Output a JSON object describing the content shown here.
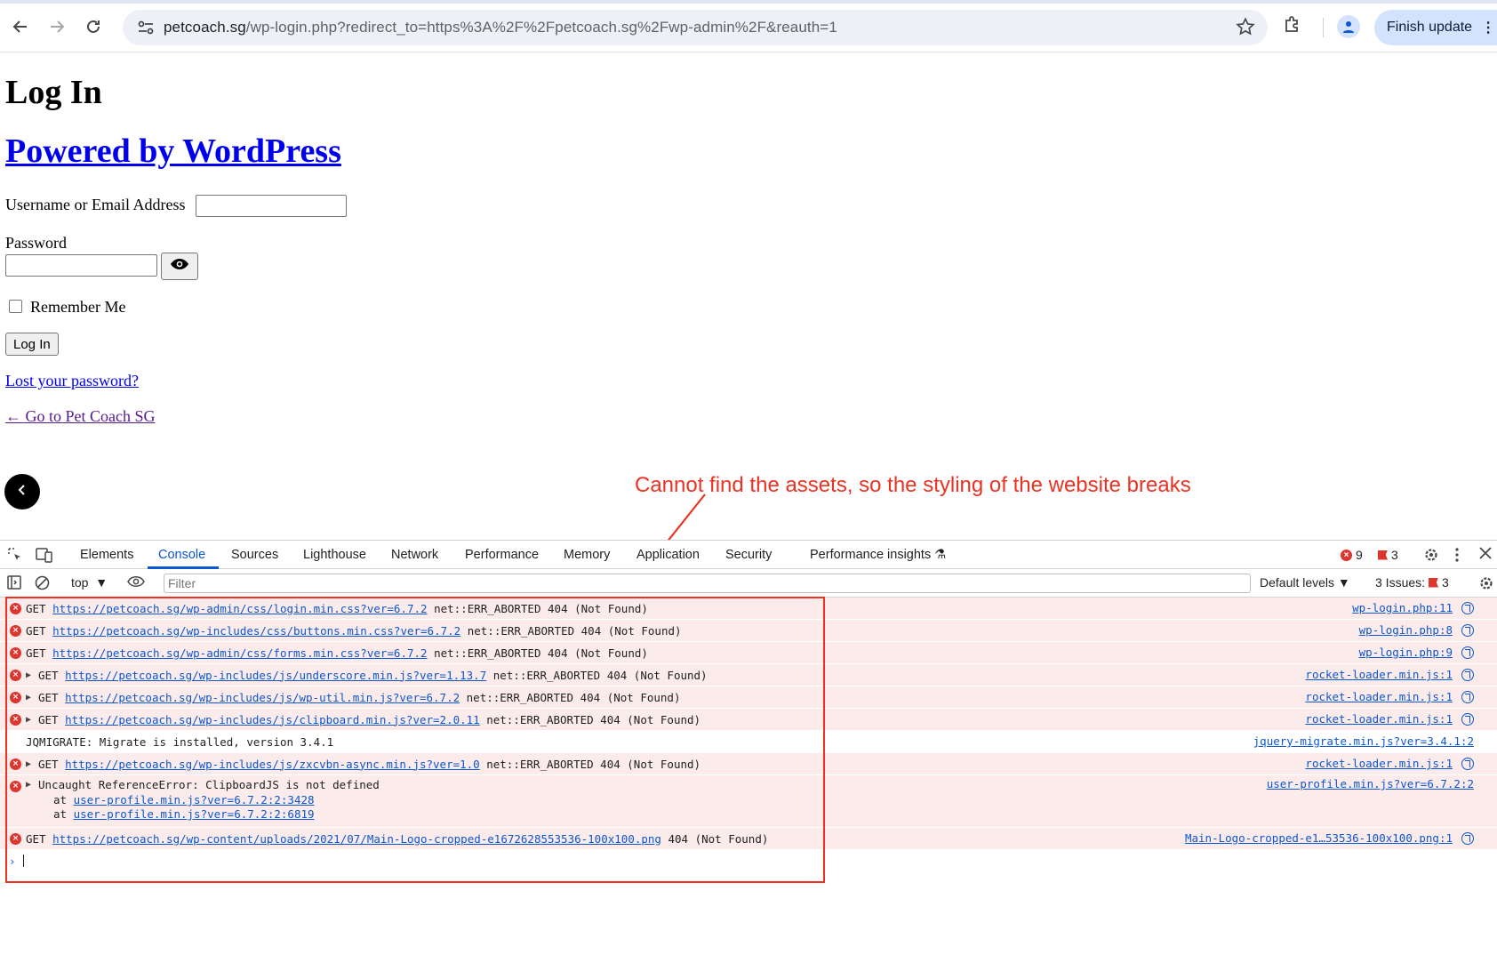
{
  "browser": {
    "url_host": "petcoach.sg",
    "url_path": "/wp-login.php?redirect_to=https%3A%2F%2Fpetcoach.sg%2Fwp-admin%2F&reauth=1",
    "finish_update_label": "Finish update",
    "icons": [
      "back-arrow-icon",
      "forward-arrow-icon",
      "reload-icon",
      "site-settings-icon",
      "star-icon",
      "extensions-icon",
      "profile-icon",
      "kebab-menu-icon"
    ]
  },
  "page": {
    "title": "Log In",
    "powered_by": "Powered by WordPress",
    "username_label": "Username or Email Address",
    "username_value": "",
    "password_label": "Password",
    "password_value": "",
    "remember_label": "Remember Me",
    "login_button": "Log In",
    "lost_password": "Lost your password?",
    "back_link": "← Go to Pet Coach SG"
  },
  "annotation": {
    "text": "Cannot find the assets, so the styling of the website breaks",
    "color": "#ea3323"
  },
  "devtools": {
    "tabs": [
      "Elements",
      "Console",
      "Sources",
      "Lighthouse",
      "Network",
      "Performance",
      "Memory",
      "Application",
      "Security",
      "Performance insights"
    ],
    "active_tab": "Console",
    "error_count": "9",
    "issue_flag_count": "3",
    "context": "top",
    "filter_placeholder": "Filter",
    "levels": "Default levels",
    "issues_label": "3 Issues:",
    "issues_count": "3",
    "console": [
      {
        "type": "error",
        "expandable": false,
        "method": "GET",
        "url": "https://petcoach.sg/wp-admin/css/login.min.css?ver=6.7.2",
        "msg": "net::ERR_ABORTED 404 (Not Found)",
        "source": "wp-login.php:11"
      },
      {
        "type": "error",
        "expandable": false,
        "method": "GET",
        "url": "https://petcoach.sg/wp-includes/css/buttons.min.css?ver=6.7.2",
        "msg": "net::ERR_ABORTED 404 (Not Found)",
        "source": "wp-login.php:8"
      },
      {
        "type": "error",
        "expandable": false,
        "method": "GET",
        "url": "https://petcoach.sg/wp-admin/css/forms.min.css?ver=6.7.2",
        "msg": "net::ERR_ABORTED 404 (Not Found)",
        "source": "wp-login.php:9"
      },
      {
        "type": "error",
        "expandable": true,
        "method": "GET",
        "url": "https://petcoach.sg/wp-includes/js/underscore.min.js?ver=1.13.7",
        "msg": "net::ERR_ABORTED 404 (Not Found)",
        "source": "rocket-loader.min.js:1"
      },
      {
        "type": "error",
        "expandable": true,
        "method": "GET",
        "url": "https://petcoach.sg/wp-includes/js/wp-util.min.js?ver=6.7.2",
        "msg": "net::ERR_ABORTED 404 (Not Found)",
        "source": "rocket-loader.min.js:1"
      },
      {
        "type": "error",
        "expandable": true,
        "method": "GET",
        "url": "https://petcoach.sg/wp-includes/js/clipboard.min.js?ver=2.0.11",
        "msg": "net::ERR_ABORTED 404 (Not Found)",
        "source": "rocket-loader.min.js:1"
      },
      {
        "type": "info",
        "text": "JQMIGRATE: Migrate is installed, version 3.4.1",
        "source": "jquery-migrate.min.js?ver=3.4.1:2"
      },
      {
        "type": "error",
        "expandable": true,
        "method": "GET",
        "url": "https://petcoach.sg/wp-includes/js/zxcvbn-async.min.js?ver=1.0",
        "msg": "net::ERR_ABORTED 404 (Not Found)",
        "source": "rocket-loader.min.js:1"
      },
      {
        "type": "exception",
        "text": "Uncaught ReferenceError: ClipboardJS is not defined",
        "stack": [
          "user-profile.min.js?ver=6.7.2:2:3428",
          "user-profile.min.js?ver=6.7.2:2:6819"
        ],
        "stack_prefix": "at",
        "source": "user-profile.min.js?ver=6.7.2:2"
      },
      {
        "type": "error",
        "expandable": false,
        "method": "GET",
        "url": "https://petcoach.sg/wp-content/uploads/2021/07/Main-Logo-cropped-e1672628553536-100x100.png",
        "msg": "404 (Not Found)",
        "source": "Main-Logo-cropped-e1…53536-100x100.png:1"
      }
    ]
  }
}
